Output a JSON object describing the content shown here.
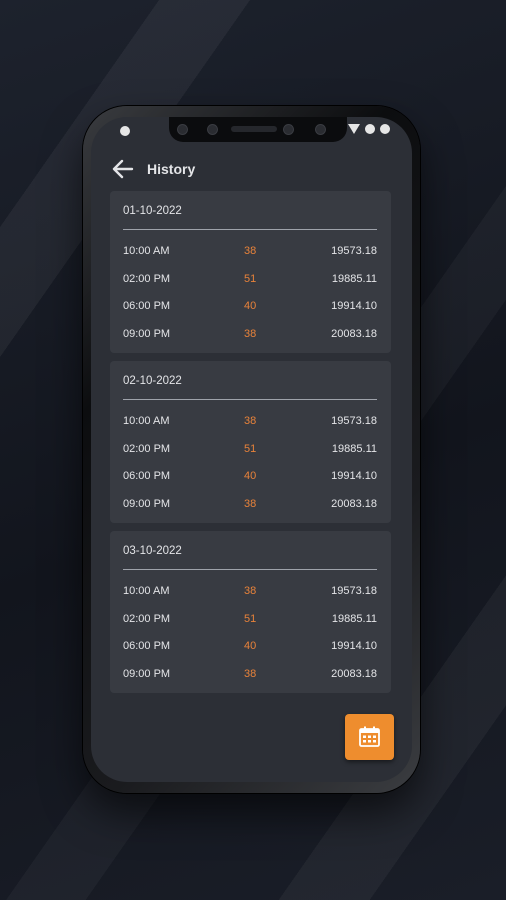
{
  "app": {
    "title": "History"
  },
  "colors": {
    "accent": "#ee8d2e",
    "count_text": "#e8823a",
    "card_bg": "#383b42",
    "screen_bg": "#2c2f36"
  },
  "icons": {
    "back": "arrow-left-icon",
    "fab": "calendar-icon"
  },
  "history": [
    {
      "date": "01-10-2022",
      "rows": [
        {
          "time": "10:00 AM",
          "count": "38",
          "value": "19573.18"
        },
        {
          "time": "02:00 PM",
          "count": "51",
          "value": "19885.11"
        },
        {
          "time": "06:00 PM",
          "count": "40",
          "value": "19914.10"
        },
        {
          "time": "09:00 PM",
          "count": "38",
          "value": "20083.18"
        }
      ]
    },
    {
      "date": "02-10-2022",
      "rows": [
        {
          "time": "10:00 AM",
          "count": "38",
          "value": "19573.18"
        },
        {
          "time": "02:00 PM",
          "count": "51",
          "value": "19885.11"
        },
        {
          "time": "06:00 PM",
          "count": "40",
          "value": "19914.10"
        },
        {
          "time": "09:00 PM",
          "count": "38",
          "value": "20083.18"
        }
      ]
    },
    {
      "date": "03-10-2022",
      "rows": [
        {
          "time": "10:00 AM",
          "count": "38",
          "value": "19573.18"
        },
        {
          "time": "02:00 PM",
          "count": "51",
          "value": "19885.11"
        },
        {
          "time": "06:00 PM",
          "count": "40",
          "value": "19914.10"
        },
        {
          "time": "09:00 PM",
          "count": "38",
          "value": "20083.18"
        }
      ]
    }
  ]
}
